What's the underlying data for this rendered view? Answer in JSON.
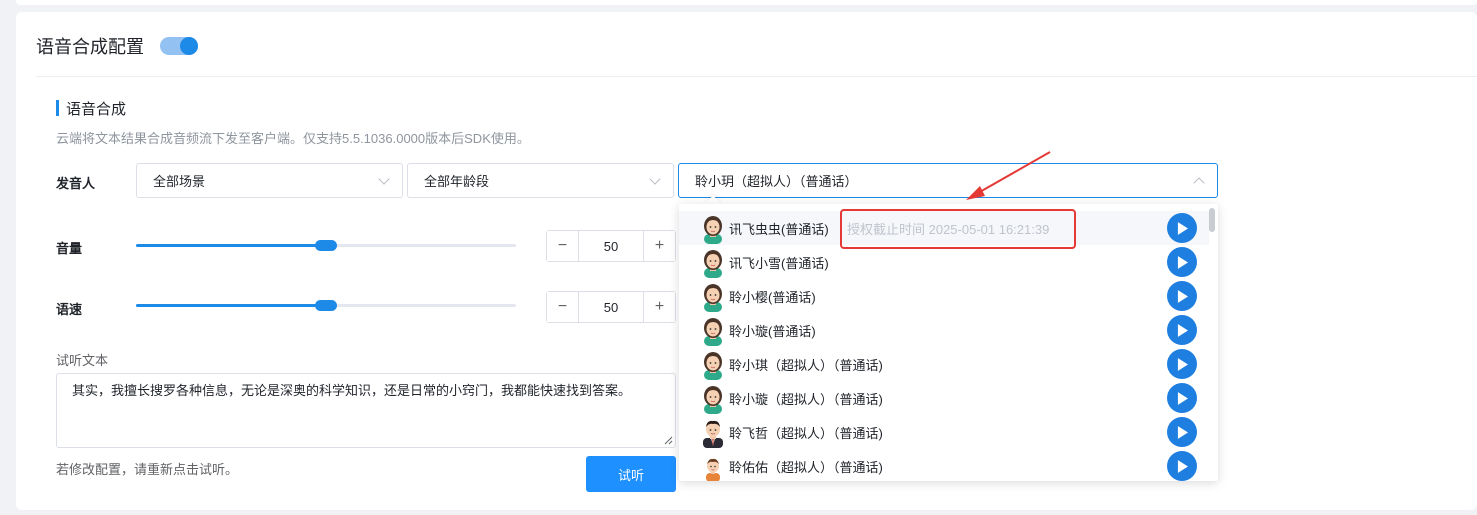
{
  "config": {
    "title": "语音合成配置",
    "enabled": true
  },
  "section": {
    "title": "语音合成",
    "description": "云端将文本结果合成音频流下发至客户端。仅支持5.5.1036.0000版本后SDK使用。"
  },
  "speaker": {
    "label": "发音人",
    "scene_select": "全部场景",
    "age_select": "全部年龄段",
    "voice_select": "聆小玥（超拟人）（普通话）"
  },
  "volume": {
    "label": "音量",
    "value": "50",
    "level_percent": 50,
    "minus": "−",
    "plus": "+"
  },
  "speed": {
    "label": "语速",
    "value": "50",
    "level_percent": 50,
    "minus": "−",
    "plus": "+"
  },
  "preview": {
    "label": "试听文本",
    "text": "其实，我擅长搜罗各种信息，无论是深奥的科学知识，还是日常的小窍门，我都能快速找到答案。",
    "hint": "若修改配置，请重新点击试听。",
    "listen_button": "试听"
  },
  "voice_options": [
    {
      "name": "讯飞虫虫(普通话)",
      "expire": "授权截止时间 2025-05-01 16:21:39",
      "avatar": "female-avatar-icon",
      "hover": true
    },
    {
      "name": "讯飞小雪(普通话)",
      "expire": "",
      "avatar": "female-avatar-icon",
      "hover": false
    },
    {
      "name": "聆小樱(普通话)",
      "expire": "",
      "avatar": "female-avatar-icon",
      "hover": false
    },
    {
      "name": "聆小璇(普通话)",
      "expire": "",
      "avatar": "female-avatar-icon",
      "hover": false
    },
    {
      "name": "聆小琪（超拟人）（普通话)",
      "expire": "",
      "avatar": "female-avatar-icon",
      "hover": false
    },
    {
      "name": "聆小璇（超拟人）（普通话)",
      "expire": "",
      "avatar": "female-avatar-icon",
      "hover": false
    },
    {
      "name": "聆飞哲（超拟人）（普通话)",
      "expire": "",
      "avatar": "male-suit-avatar-icon",
      "hover": false
    },
    {
      "name": "聆佑佑（超拟人）（普通话)",
      "expire": "",
      "avatar": "child-avatar-icon",
      "hover": false
    }
  ],
  "colors": {
    "accent": "#1e8ae7",
    "button": "#1e90ff",
    "annotation": "#e53935"
  }
}
